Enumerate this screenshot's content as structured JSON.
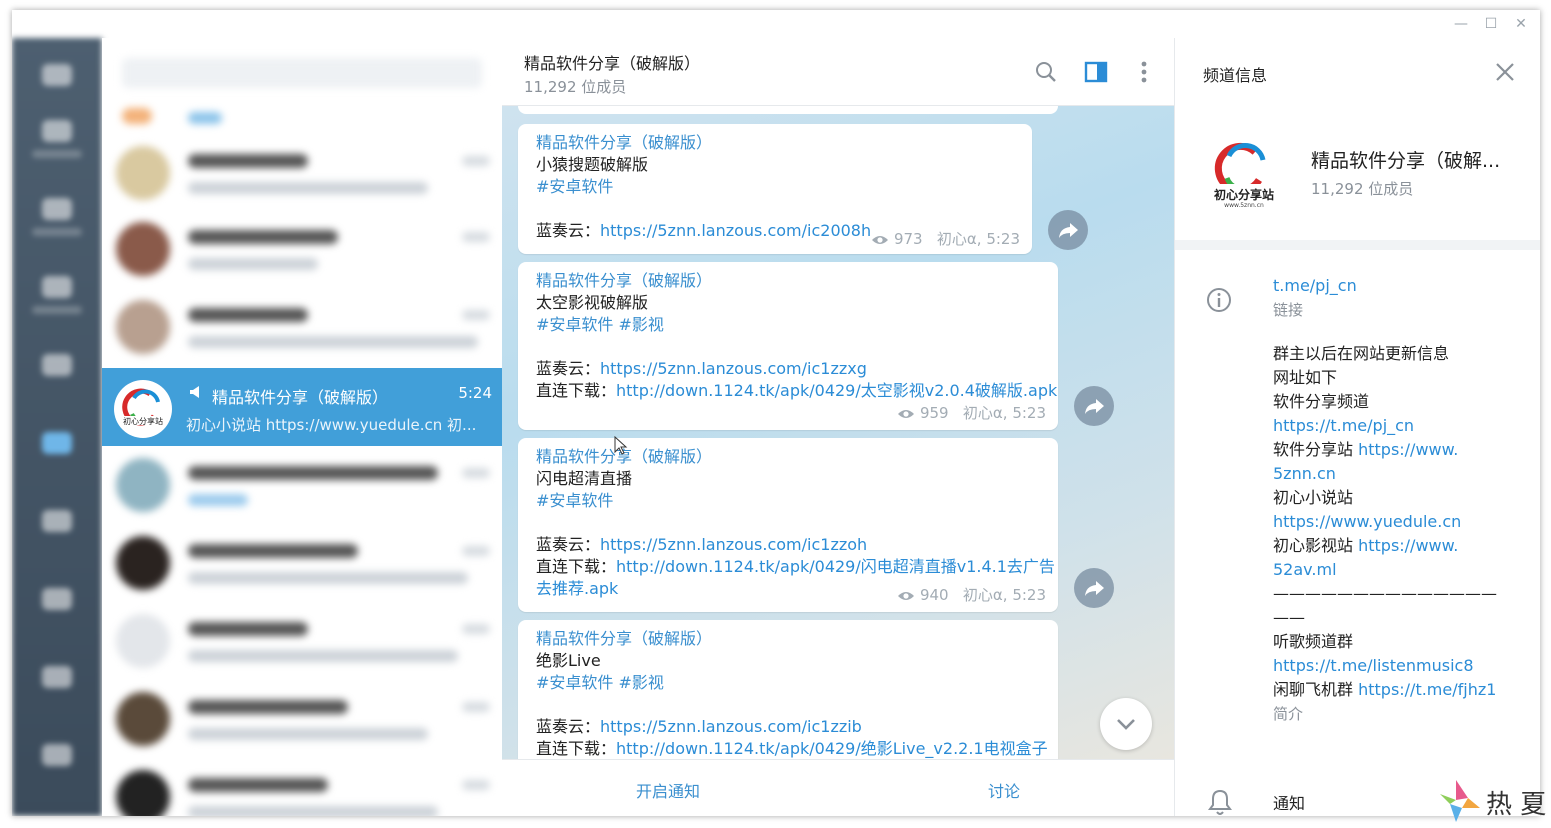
{
  "window": {
    "controls": {
      "minimize": "—",
      "maximize": "☐",
      "close": "✕"
    }
  },
  "chat_list": {
    "active_chat": {
      "icon": "megaphone-icon",
      "title": "精品软件分享（破解版）",
      "time": "5:24",
      "preview": "初心小说站 https://www.yuedule.cn 初..."
    }
  },
  "channel": {
    "title": "精品软件分享（破解版）",
    "subtitle": "11,292 位成员",
    "footer": {
      "notify_label": "开启通知",
      "discuss_label": "讨论"
    }
  },
  "messages": [
    {
      "author": "精品软件分享（破解版）",
      "title": "小猿搜题破解版",
      "tags": "#安卓软件",
      "lanzou_label": "蓝奏云：",
      "lanzou_url": "https://5znn.lanzous.com/ic2008h",
      "views": "973",
      "signature": "初心α, 5:23"
    },
    {
      "author": "精品软件分享（破解版）",
      "title": "太空影视破解版",
      "tags": "#安卓软件 #影视",
      "lanzou_label": "蓝奏云：",
      "lanzou_url": "https://5znn.lanzous.com/ic1zzxg",
      "direct_label": "直连下载：",
      "direct_url": "http://down.1124.tk/apk/0429/太空影视v2.0.4破解版.apk",
      "views": "959",
      "signature": "初心α, 5:23"
    },
    {
      "author": "精品软件分享（破解版）",
      "title": "闪电超清直播",
      "tags": "#安卓软件",
      "lanzou_label": "蓝奏云：",
      "lanzou_url": "https://5znn.lanzous.com/ic1zzoh",
      "direct_label": "直连下载：",
      "direct_url": "http://down.1124.tk/apk/0429/闪电超清直播v1.4.1去广告",
      "direct_url_cont": "去推荐.apk",
      "views": "940",
      "signature": "初心α, 5:23"
    },
    {
      "author": "精品软件分享（破解版）",
      "title": "绝影Live",
      "tags": "#安卓软件 #影视",
      "lanzou_label": "蓝奏云：",
      "lanzou_url": "https://5znn.lanzous.com/ic1zzib",
      "direct_label": "直连下载：",
      "direct_url": "http://down.1124.tk/apk/0429/绝影Live_v2.2.1电视盒子"
    }
  ],
  "info_panel": {
    "header": "频道信息",
    "name": "精品软件分享（破解...",
    "members": "11,292 位成员",
    "logo_text": "初心分享站",
    "logo_sub": "www.5znn.cn",
    "link": "t.me/pj_cn",
    "link_label": "链接",
    "description_lines": {
      "l1": "群主以后在网站更新信息",
      "l2": "网址如下",
      "l3": "软件分享频道",
      "l4": "https://t.me/pj_cn",
      "l5_text": "软件分享站 ",
      "l5_link": "https://www.",
      "l6": "5znn.cn",
      "l7": "初心小说站",
      "l8": "https://www.yuedule.cn",
      "l9_text": "初心影视站 ",
      "l9_link": "https://www.",
      "l10": "52av.ml",
      "l11": "——————————————",
      "l12": "——",
      "l13": "听歌频道群",
      "l14": "https://t.me/listenmusic8",
      "l15_text": "闲聊飞机群 ",
      "l15_link": "https://t.me/fjhz1"
    },
    "description_label": "简介",
    "notifications_label": "通知"
  },
  "watermark": {
    "text": "热 夏"
  },
  "colors": {
    "accent": "#419fd9",
    "link": "#2b8cd6"
  }
}
